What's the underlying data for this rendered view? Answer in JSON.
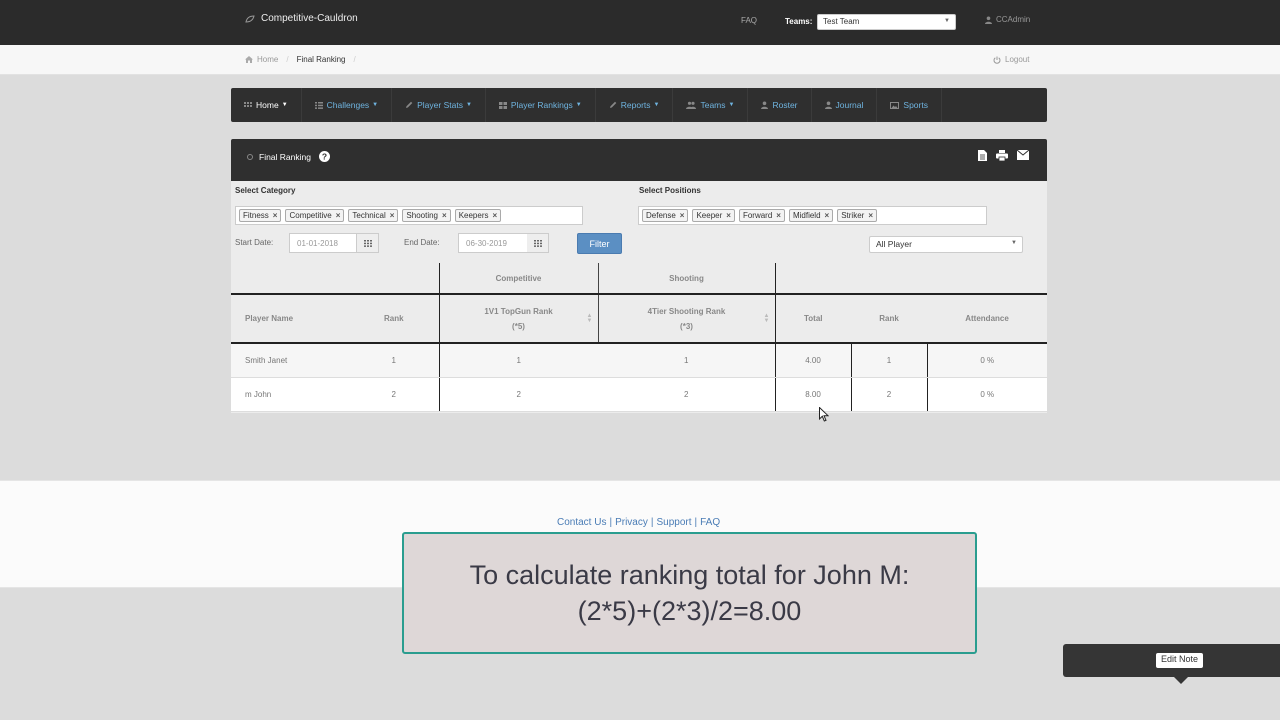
{
  "topbar": {
    "brand": "Competitive-Cauldron",
    "faq": "FAQ",
    "teams_label": "Teams:",
    "team_selected": "Test Team",
    "user": "CCAdmin"
  },
  "breadcrumb": {
    "home": "Home",
    "current": "Final Ranking",
    "logout": "Logout"
  },
  "menu": [
    {
      "label": "Home",
      "icon": "grid-icon",
      "dropdown": true
    },
    {
      "label": "Challenges",
      "icon": "list-icon",
      "dropdown": true
    },
    {
      "label": "Player Stats",
      "icon": "pencil-icon",
      "dropdown": true
    },
    {
      "label": "Player Rankings",
      "icon": "grid-icon",
      "dropdown": true
    },
    {
      "label": "Reports",
      "icon": "pencil-icon",
      "dropdown": true
    },
    {
      "label": "Teams",
      "icon": "users-icon",
      "dropdown": true
    },
    {
      "label": "Roster",
      "icon": "user-icon",
      "dropdown": false
    },
    {
      "label": "Journal",
      "icon": "user-icon",
      "dropdown": false
    },
    {
      "label": "Sports",
      "icon": "image-icon",
      "dropdown": false
    }
  ],
  "panel": {
    "title": "Final Ranking",
    "actions": [
      "file-icon",
      "print-icon",
      "mail-icon"
    ]
  },
  "filters": {
    "category_label": "Select Category",
    "categories": [
      "Fitness",
      "Competitive",
      "Technical",
      "Shooting",
      "Keepers"
    ],
    "positions_label": "Select Positions",
    "positions": [
      "Defense",
      "Keeper",
      "Forward",
      "Midfield",
      "Striker"
    ],
    "start_label": "Start Date:",
    "start_value": "01-01-2018",
    "end_label": "End Date:",
    "end_value": "06-30-2019",
    "filter_button": "Filter",
    "player_filter": "All Player"
  },
  "table": {
    "groups": {
      "competitive": "Competitive",
      "shooting": "Shooting"
    },
    "headers": {
      "player_name": "Player Name",
      "rank": "Rank",
      "topgun": "1V1 TopGun Rank",
      "topgun_weight": "(*5)",
      "shooting": "4Tier Shooting Rank",
      "shooting_weight": "(*3)",
      "total": "Total",
      "rank2": "Rank",
      "attendance": "Attendance"
    },
    "rows": [
      {
        "name": "Smith Janet",
        "rank": "1",
        "topgun": "1",
        "shooting": "1",
        "total": "4.00",
        "rank2": "1",
        "attendance": "0 %"
      },
      {
        "name": "m John",
        "rank": "2",
        "topgun": "2",
        "shooting": "2",
        "total": "8.00",
        "rank2": "2",
        "attendance": "0 %"
      }
    ]
  },
  "footer": {
    "contact": "Contact Us",
    "privacy": "Privacy",
    "support": "Support",
    "faq": "FAQ",
    "sep": "|"
  },
  "caption": {
    "line1": "To calculate ranking total for John M:",
    "line2": "(2*5)+(2*3)/2=8.00"
  },
  "note": {
    "button": "Edit Note"
  }
}
